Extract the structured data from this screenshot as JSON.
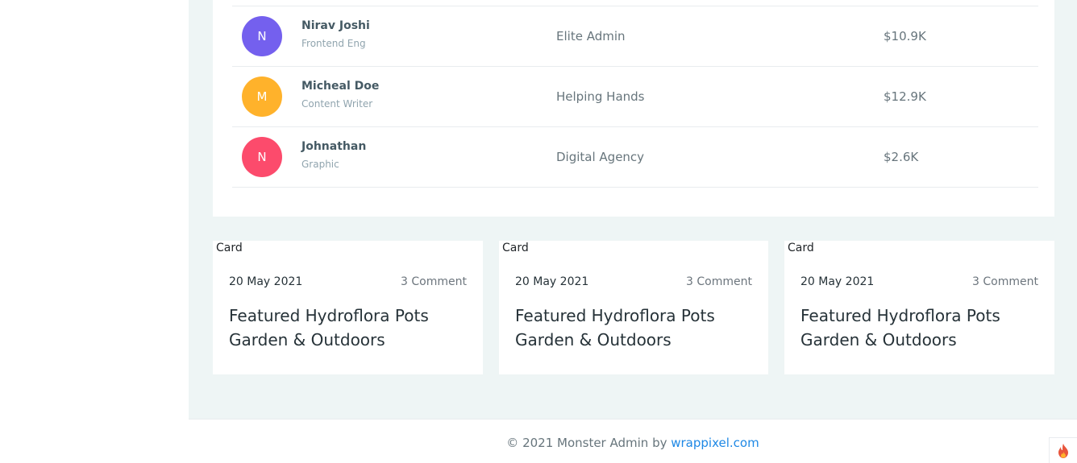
{
  "projects": [
    {
      "initial": "N",
      "name": "Nirav Joshi",
      "role": "Frontend Eng",
      "project": "Elite Admin",
      "budget": "$10.9K",
      "color": "#7460ee"
    },
    {
      "initial": "M",
      "name": "Micheal Doe",
      "role": "Content Writer",
      "project": "Helping Hands",
      "budget": "$12.9K",
      "color": "#ffb22b"
    },
    {
      "initial": "N",
      "name": "Johnathan",
      "role": "Graphic",
      "project": "Digital Agency",
      "budget": "$2.6K",
      "color": "#fc4b6c"
    }
  ],
  "blog_cards": [
    {
      "img_alt": "Card",
      "date": "20 May 2021",
      "comments": "3 Comment",
      "title": "Featured Hydroflora Pots Garden & Outdoors"
    },
    {
      "img_alt": "Card",
      "date": "20 May 2021",
      "comments": "3 Comment",
      "title": "Featured Hydroflora Pots Garden & Outdoors"
    },
    {
      "img_alt": "Card",
      "date": "20 May 2021",
      "comments": "3 Comment",
      "title": "Featured Hydroflora Pots Garden & Outdoors"
    }
  ],
  "footer": {
    "text": "© 2021 Monster Admin by ",
    "link": "wrappixel.com"
  },
  "icons": {
    "fire": "fire-icon",
    "broken_image": "broken-image-icon"
  },
  "colors": {
    "background": "#eef5f5",
    "link": "#1e88e5",
    "fire": "#e8553c"
  }
}
